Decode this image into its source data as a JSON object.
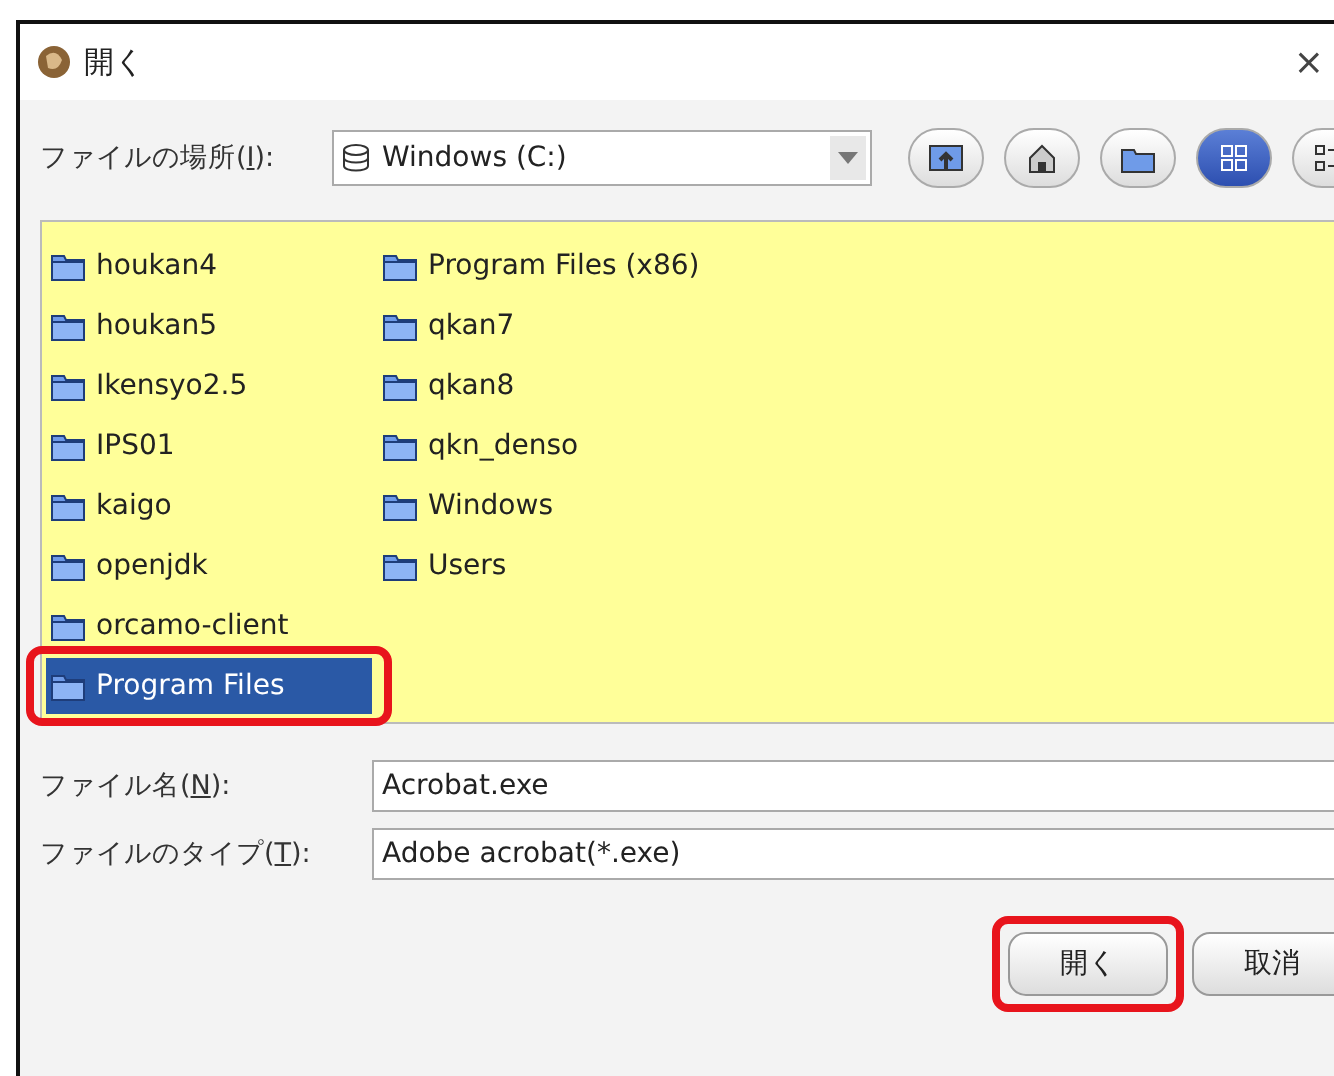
{
  "window": {
    "title": "開く",
    "close": "×"
  },
  "location": {
    "label": {
      "before": "ファイルの場所(",
      "key": "I",
      "after": "):"
    },
    "value": "Windows (C:)"
  },
  "toolbar": [
    {
      "kind": "up",
      "selected": false
    },
    {
      "kind": "home",
      "selected": false
    },
    {
      "kind": "newfolder",
      "selected": false
    },
    {
      "kind": "list",
      "selected": true
    },
    {
      "kind": "details",
      "selected": false
    }
  ],
  "files": [
    {
      "name": "houkan4",
      "selected": false,
      "highlighted": false
    },
    {
      "name": "houkan5",
      "selected": false,
      "highlighted": false
    },
    {
      "name": "Ikensyo2.5",
      "selected": false,
      "highlighted": false
    },
    {
      "name": "IPS01",
      "selected": false,
      "highlighted": false
    },
    {
      "name": "kaigo",
      "selected": false,
      "highlighted": false
    },
    {
      "name": "openjdk",
      "selected": false,
      "highlighted": false
    },
    {
      "name": "orcamo-client",
      "selected": false,
      "highlighted": false
    },
    {
      "name": "Program Files",
      "selected": true,
      "highlighted": true
    },
    {
      "name": "Program Files (x86)",
      "selected": false,
      "highlighted": false
    },
    {
      "name": "qkan7",
      "selected": false,
      "highlighted": false
    },
    {
      "name": "qkan8",
      "selected": false,
      "highlighted": false
    },
    {
      "name": "qkn_denso",
      "selected": false,
      "highlighted": false
    },
    {
      "name": "Windows",
      "selected": false,
      "highlighted": false
    },
    {
      "name": "Users",
      "selected": false,
      "highlighted": false
    }
  ],
  "file_name": {
    "label": {
      "before": "ファイル名(",
      "key": "N",
      "after": "):"
    },
    "value": "Acrobat.exe"
  },
  "file_type": {
    "label": {
      "before": "ファイルのタイプ(",
      "key": "T",
      "after": "):"
    },
    "value": "Adobe acrobat(*.exe)"
  },
  "buttons": [
    {
      "label": "開く",
      "highlighted": true
    },
    {
      "label": "取消",
      "highlighted": false
    }
  ]
}
